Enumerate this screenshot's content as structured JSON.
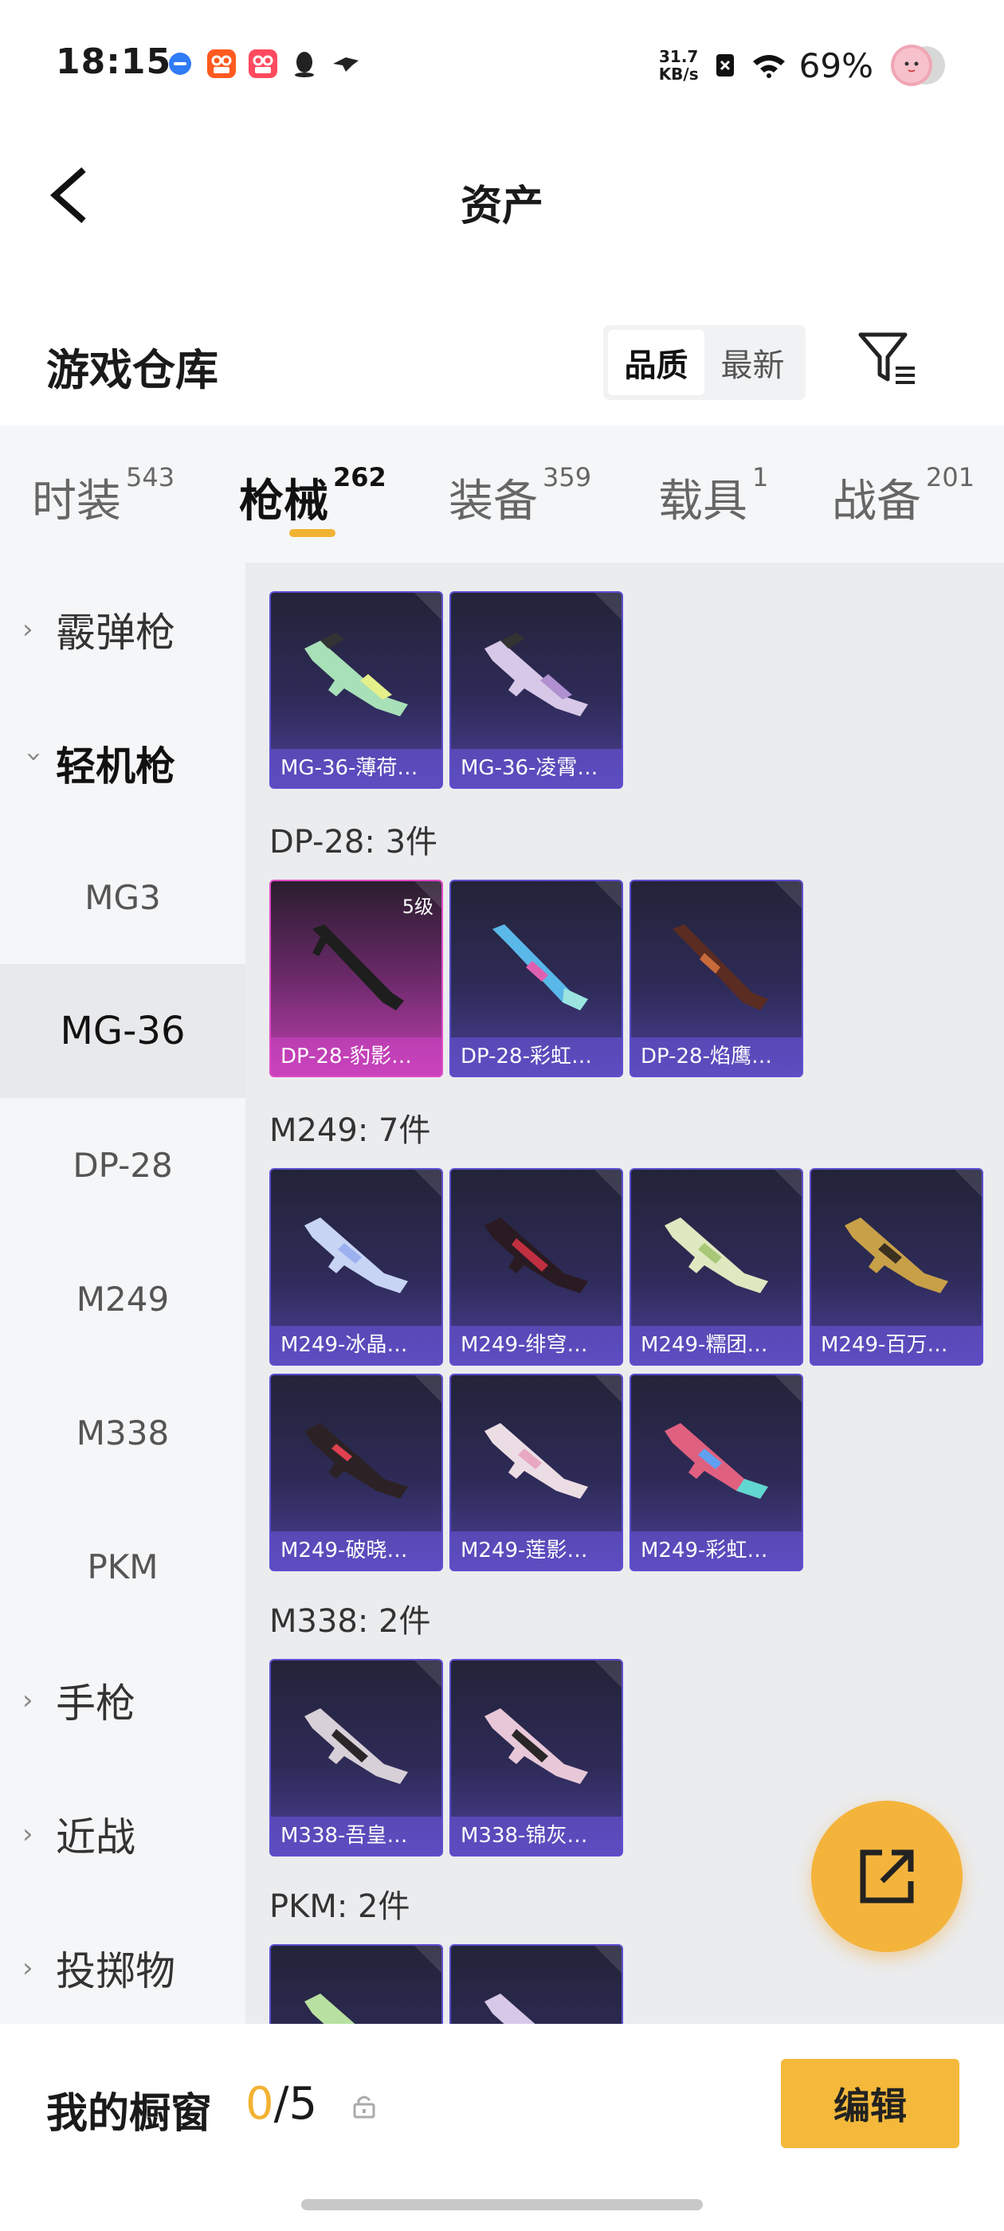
{
  "status_bar": {
    "time": "18:15",
    "speed_top": "31.7",
    "speed_bottom": "KB/s",
    "battery": "69%"
  },
  "header": {
    "title": "资产"
  },
  "warehouse": {
    "title": "游戏仓库",
    "sort_options": [
      "品质",
      "最新"
    ],
    "sort_selected": "品质"
  },
  "tabs": [
    {
      "label": "时装",
      "count": "543"
    },
    {
      "label": "枪械",
      "count": "262",
      "active": true
    },
    {
      "label": "装备",
      "count": "359"
    },
    {
      "label": "载具",
      "count": "1"
    },
    {
      "label": "战备",
      "count": "201"
    }
  ],
  "left_nav": {
    "shotgun": "霰弹枪",
    "lmg": "轻机枪",
    "lmg_subs": [
      "MG3",
      "MG-36",
      "DP-28",
      "M249",
      "M338",
      "PKM"
    ],
    "active_sub": "MG-36",
    "pistol": "手枪",
    "melee": "近战",
    "throwable": "投掷物"
  },
  "sections": {
    "mg36_items": [
      "MG-36-薄荷…",
      "MG-36-凌霄…"
    ],
    "dp28_title": "DP-28: 3件",
    "dp28_items": [
      "DP-28-豹影…",
      "DP-28-彩虹…",
      "DP-28-焰鹰…"
    ],
    "dp28_level": "5级",
    "m249_title": "M249: 7件",
    "m249_items": [
      "M249-冰晶…",
      "M249-绯穹…",
      "M249-糯团…",
      "M249-百万…",
      "M249-破晓…",
      "M249-莲影…",
      "M249-彩虹…"
    ],
    "m338_title": "M338: 2件",
    "m338_items": [
      "M338-吾皇…",
      "M338-锦灰…"
    ],
    "pkm_title": "PKM: 2件"
  },
  "bottom": {
    "label": "我的橱窗",
    "current": "0",
    "total": "/5",
    "edit": "编辑"
  },
  "colors": {
    "accent": "#f4b93a",
    "card_purple": "#4a3f96",
    "card_pink": "#c040b0"
  }
}
